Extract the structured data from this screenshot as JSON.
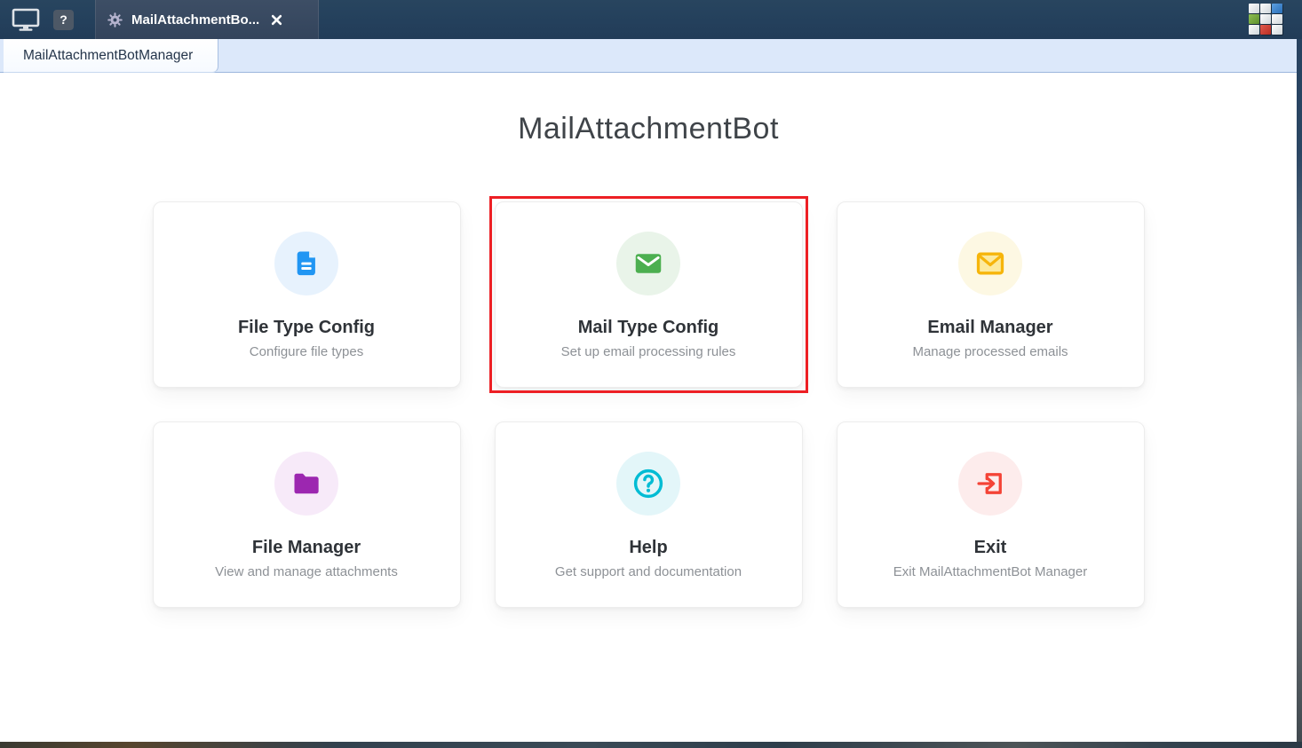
{
  "window": {
    "toolbar": {
      "monitor_icon": "monitor-icon",
      "help_badge": "?",
      "editor_tab": {
        "gear_icon": "gear-icon",
        "label": "MailAttachmentBo...",
        "close_icon": "close-x"
      },
      "logo_icon": "cube-grid-logo"
    },
    "view_tab": {
      "label": "MailAttachmentBotManager"
    }
  },
  "main": {
    "title": "MailAttachmentBot",
    "highlight_color": "#ed1f24",
    "cards": [
      {
        "id": "file-type-config",
        "title": "File Type Config",
        "subtitle": "Configure file types",
        "icon": "document-icon",
        "icon_color": "#2196f3",
        "circle_color": "#e7f2fd",
        "highlighted": false
      },
      {
        "id": "mail-type-config",
        "title": "Mail Type Config",
        "subtitle": "Set up email processing rules",
        "icon": "mail-filled-icon",
        "icon_color": "#4caf50",
        "circle_color": "#e9f4e9",
        "highlighted": true
      },
      {
        "id": "email-manager",
        "title": "Email Manager",
        "subtitle": "Manage processed emails",
        "icon": "mail-outline-icon",
        "icon_color": "#f6b50b",
        "circle_color": "#fdf8e3",
        "highlighted": false
      },
      {
        "id": "file-manager",
        "title": "File Manager",
        "subtitle": "View and manage attachments",
        "icon": "folder-icon",
        "icon_color": "#9c27b0",
        "circle_color": "#f7eaf9",
        "highlighted": false
      },
      {
        "id": "help",
        "title": "Help",
        "subtitle": "Get support and documentation",
        "icon": "help-icon",
        "icon_color": "#00bcd4",
        "circle_color": "#e3f6f9",
        "highlighted": false
      },
      {
        "id": "exit",
        "title": "Exit",
        "subtitle": "Exit MailAttachmentBot Manager",
        "icon": "exit-icon",
        "icon_color": "#f44336",
        "circle_color": "#fdecec",
        "highlighted": false
      }
    ]
  }
}
